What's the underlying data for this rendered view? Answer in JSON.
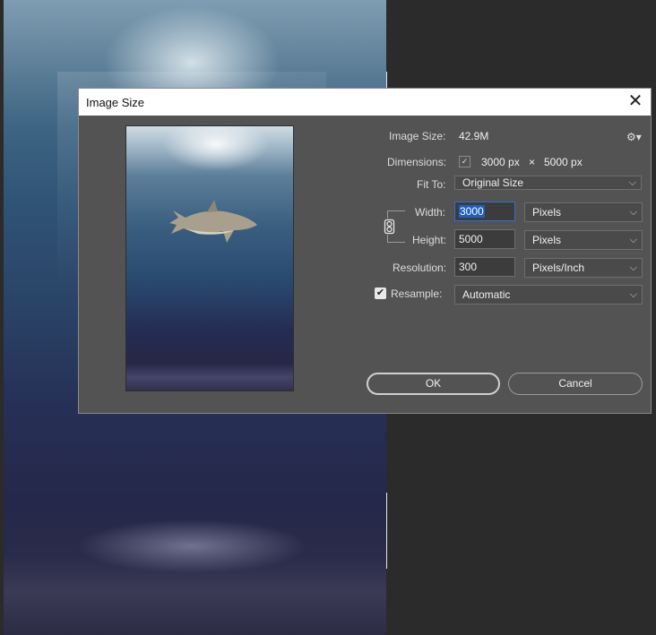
{
  "dialog": {
    "title": "Image Size",
    "close_glyph": "✕",
    "settings_icon": "gear-icon",
    "image_size_label": "Image Size:",
    "image_size_value": "42.9M",
    "dimensions_label": "Dimensions:",
    "dimensions_width": "3000 px",
    "dimensions_times": "×",
    "dimensions_height": "5000 px",
    "fit_to_label": "Fit To:",
    "fit_to_value": "Original Size",
    "width_label": "Width:",
    "width_value": "3000",
    "width_unit": "Pixels",
    "height_label": "Height:",
    "height_value": "5000",
    "height_unit": "Pixels",
    "resolution_label": "Resolution:",
    "resolution_value": "300",
    "resolution_unit": "Pixels/Inch",
    "resample_label": "Resample:",
    "resample_checked": true,
    "resample_value": "Automatic",
    "ok_label": "OK",
    "cancel_label": "Cancel"
  },
  "colors": {
    "dialog_bg": "#535353",
    "field_bg": "#3c3c3c",
    "active_border": "#2f6fd6",
    "selection": "#1e5fbf"
  }
}
